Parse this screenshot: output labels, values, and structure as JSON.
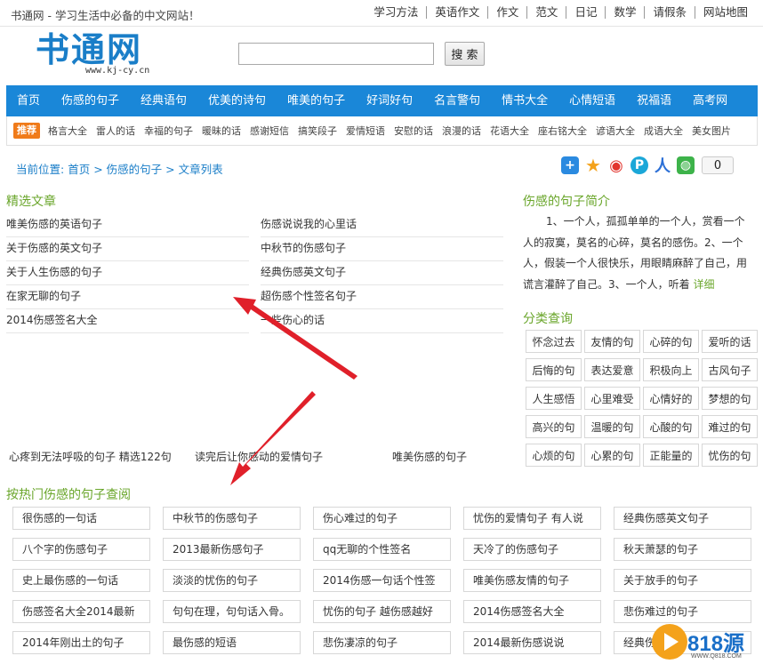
{
  "header": {
    "slogan": "书通网 - 学习生活中必备的中文网站！",
    "top_links": [
      "学习方法",
      "英语作文",
      "作文",
      "范文",
      "日记",
      "数学",
      "请假条",
      "网站地图"
    ],
    "logo_text": "书通网",
    "logo_url": "www.kj-cy.cn"
  },
  "search": {
    "button_label": "搜 索",
    "value": ""
  },
  "nav": {
    "items": [
      "首页",
      "伤感的句子",
      "经典语句",
      "优美的诗句",
      "唯美的句子",
      "好词好句",
      "名言警句",
      "情书大全",
      "心情短语",
      "祝福语",
      "高考网"
    ]
  },
  "recommend": {
    "tag": "推荐",
    "items": [
      "格言大全",
      "雷人的话",
      "幸福的句子",
      "暖昧的话",
      "感谢短信",
      "搞笑段子",
      "爱情短语",
      "安慰的话",
      "浪漫的话",
      "花语大全",
      "座右铭大全",
      "谚语大全",
      "成语大全",
      "美女图片"
    ]
  },
  "breadcrumb": {
    "prefix": "当前位置:",
    "items": [
      "首页",
      "伤感的句子",
      "文章列表"
    ],
    "separator": ">"
  },
  "share": {
    "count": "0"
  },
  "featured": {
    "title": "精选文章",
    "left": [
      "唯美伤感的英语句子",
      "关于伤感的英文句子",
      "关于人生伤感的句子",
      "在家无聊的句子",
      "2014伤感签名大全"
    ],
    "right": [
      "伤感说说我的心里话",
      "中秋节的伤感句子",
      "经典伤感英文句子",
      "超伤感个性签名句子",
      "一些伤心的话"
    ]
  },
  "bottom_links": [
    "心疼到无法呼吸的句子 精选122句",
    "读完后让你感动的爱情句子",
    "唯美伤感的句子"
  ],
  "intro": {
    "title": "伤感的句子简介",
    "text": "1、一个人，孤孤单单的一个人，赏看一个人的寂寞，莫名的心碎，莫名的感伤。2、一个人，假装一个人很快乐，用眼睛麻醉了自己，用谎言灌醉了自己。3、一个人，听着",
    "more": "详细"
  },
  "categories": {
    "title": "分类查询",
    "items": [
      "怀念过去",
      "友情的句",
      "心碎的句",
      "爱听的话",
      "后悔的句",
      "表达爱意",
      "积极向上",
      "古风句子",
      "人生感悟",
      "心里难受",
      "心情好的",
      "梦想的句",
      "高兴的句",
      "温暖的句",
      "心酸的句",
      "难过的句",
      "心烦的句",
      "心累的句",
      "正能量的",
      "忧伤的句"
    ]
  },
  "hot": {
    "title": "按热门伤感的句子查阅",
    "items": [
      "很伤感的一句话",
      "中秋节的伤感句子",
      "伤心难过的句子",
      "忧伤的爱情句子 有人说",
      "经典伤感英文句子",
      "八个字的伤感句子",
      "2013最新伤感句子",
      "qq无聊的个性签名",
      "天冷了的伤感句子",
      "秋天萧瑟的句子",
      "史上最伤感的一句话",
      "淡淡的忧伤的句子",
      "2014伤感一句话个性签",
      "唯美伤感友情的句子",
      "关于放手的句子",
      "伤感签名大全2014最新",
      "句句在理，句句话入骨。",
      "忧伤的句子 越伤感越好",
      "2014伤感签名大全",
      "悲伤难过的句子",
      "2014年刚出土的句子",
      "最伤感的短语",
      "悲伤凄凉的句子",
      "2014最新伤感说说",
      "经典伤"
    ]
  },
  "watermark": {
    "text": "818源码",
    "url": "WWW.Q818.COM"
  },
  "colors": {
    "nav_bg": "#1a87d8",
    "accent_green": "#6aa62b",
    "link_blue": "#1a7ec8",
    "tag_orange": "#f07b1a",
    "arrow_red": "#e0202a"
  }
}
